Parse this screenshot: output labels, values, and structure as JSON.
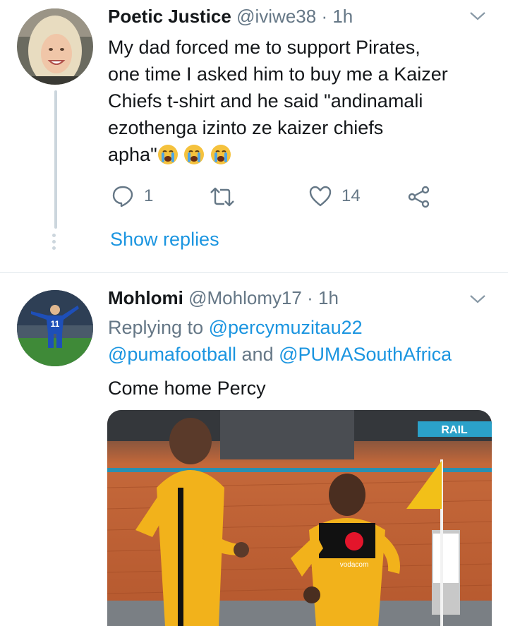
{
  "tweet1": {
    "name": "Poetic Justice",
    "handle": "@iviwe38",
    "sep": "·",
    "time": "1h",
    "lines": [
      "My dad forced me to support Pirates,",
      "one time I asked him to buy me a Kaizer",
      "Chiefs t-shirt and he said \"andinamali",
      "ezothenga izinto ze kaizer chiefs",
      "apha\""
    ],
    "emoji_names": [
      "loudly-crying-face",
      "loudly-crying-face",
      "loudly-crying-face"
    ],
    "reply_count": "1",
    "retweet_count": "",
    "like_count": "14",
    "show_replies": "Show replies"
  },
  "tweet2": {
    "name": "Mohlomi",
    "handle": "@Mohlomy17",
    "sep": "·",
    "time": "1h",
    "replying_prefix": "Replying to",
    "mention1": "@percymuzitau22",
    "mention2": "@pumafootball",
    "and_word": "and",
    "mention3": "@PUMASouthAfrica",
    "text": "Come home Percy",
    "photo_jersey_number": "11",
    "media_sponsor": "vodacom",
    "media_banner": "RAIL"
  },
  "colors": {
    "accent": "#1b95e0",
    "meta": "#657786",
    "line": "#ccd6dd",
    "jersey_yellow": "#f2b21b"
  }
}
